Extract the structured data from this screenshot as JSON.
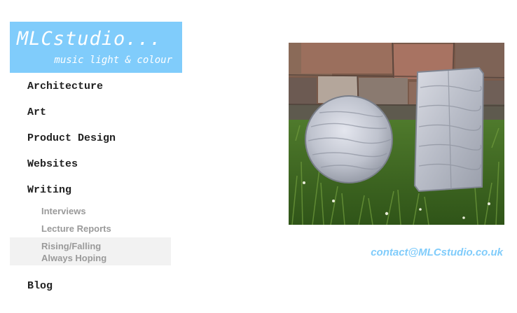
{
  "logo": {
    "title": "MLCstudio...",
    "tagline": "music light & colour"
  },
  "nav": {
    "items": [
      {
        "label": "Architecture"
      },
      {
        "label": "Art"
      },
      {
        "label": "Product Design"
      },
      {
        "label": "Websites"
      },
      {
        "label": "Writing"
      },
      {
        "label": "Blog"
      }
    ],
    "writing_sub": [
      {
        "label": "Interviews"
      },
      {
        "label": "Lecture Reports"
      },
      {
        "label_line1": "Rising/Falling",
        "label_line2": "Always Hoping",
        "selected": true
      }
    ]
  },
  "contact": {
    "email": "contact@MLCstudio.co.uk"
  },
  "colors": {
    "brand": "#80ccfb",
    "nav_text": "#222222",
    "sub_text": "#9a9a9a",
    "selected_bg": "#f2f2f2"
  }
}
